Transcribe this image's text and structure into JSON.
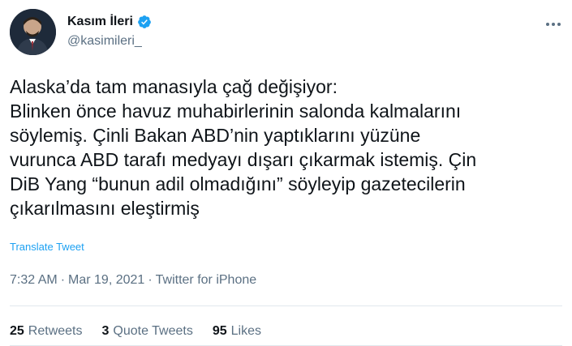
{
  "author": {
    "display_name": "Kasım İleri",
    "handle": "@kasimileri_",
    "verified": true,
    "avatar_icon": "person-avatar"
  },
  "tweet": {
    "lines": [
      "Alaska’da tam manasıyla çağ değişiyor:",
      "Blinken önce havuz muhabirlerinin salonda kalmalarını",
      "söylemiş. Çinli Bakan ABD’nin yaptıklarını yüzüne",
      "vurunca ABD tarafı medyayı dışarı çıkarmak istemiş. Çin",
      "DiB Yang “bunun adil olmadığını” söyleyip gazetecilerin",
      "çıkarılmasını eleştirmiş"
    ],
    "translate_label": "Translate Tweet",
    "time": "7:32 AM",
    "separator": "·",
    "date": "Mar 19, 2021",
    "source": "Twitter for iPhone"
  },
  "stats": {
    "retweets_count": "25",
    "retweets_label": "Retweets",
    "quotes_count": "3",
    "quotes_label": "Quote Tweets",
    "likes_count": "95",
    "likes_label": "Likes"
  },
  "colors": {
    "accent": "#1da1f2",
    "secondary_text": "#5b7083",
    "primary_text": "#0f1419",
    "divider": "#e1e8ed"
  },
  "icons": {
    "verified": "verified-badge-icon",
    "more": "more-options-icon"
  }
}
